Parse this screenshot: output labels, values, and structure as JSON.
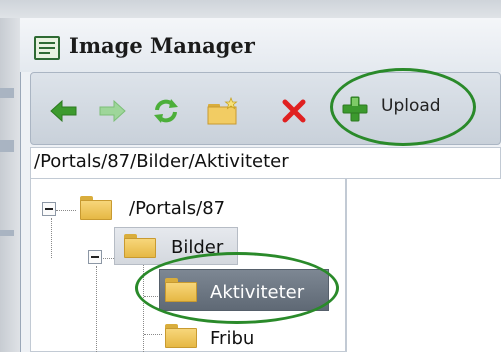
{
  "window": {
    "title": "Image Manager"
  },
  "toolbar": {
    "buttons": [
      {
        "name": "back",
        "icon": "arrow-left-icon",
        "color": "#3c9a2e"
      },
      {
        "name": "forward",
        "icon": "arrow-right-icon",
        "color": "#8fcf8a"
      },
      {
        "name": "refresh",
        "icon": "refresh-icon",
        "color": "#4caf3a"
      },
      {
        "name": "new-folder",
        "icon": "new-folder-icon",
        "color": "#e6b844"
      },
      {
        "name": "delete",
        "icon": "delete-x-icon",
        "color": "#e02020"
      }
    ],
    "upload_label": "Upload",
    "upload_icon": "plus-icon",
    "upload_icon_color": "#3c9a2e"
  },
  "path": {
    "value": "/Portals/87/Bilder/Aktiviteter"
  },
  "tree": {
    "nodes": [
      {
        "label": "/Portals/87",
        "expanded": true
      },
      {
        "label": "Bilder",
        "expanded": true
      },
      {
        "label": "Aktiviteter",
        "selected": true
      },
      {
        "label": "Fribu"
      }
    ]
  },
  "highlight_color": "#2a8a2a"
}
